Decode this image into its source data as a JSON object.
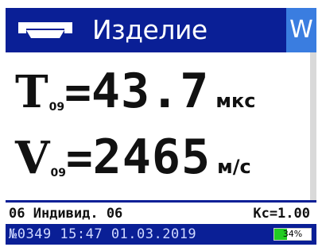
{
  "header": {
    "title": "Изделие",
    "mode_label": "W",
    "icon": "probe-icon"
  },
  "metrics": [
    {
      "symbol": "T",
      "subscript": "09",
      "equals": "=",
      "value": "43.7",
      "unit": "мкс"
    },
    {
      "symbol": "V",
      "subscript": "09",
      "equals": "=",
      "value": "2465",
      "unit": "м/с"
    }
  ],
  "info": {
    "left": "06 Индивид. 06",
    "right": "Кс=1.00"
  },
  "status": {
    "text": "№0349 15:47 01.03.2019",
    "battery_label": "34%",
    "battery_level": 0.34
  },
  "colors": {
    "header_bg": "#0a1f96",
    "mode_bg": "#3a7de0",
    "battery_fill": "#22cc22"
  }
}
